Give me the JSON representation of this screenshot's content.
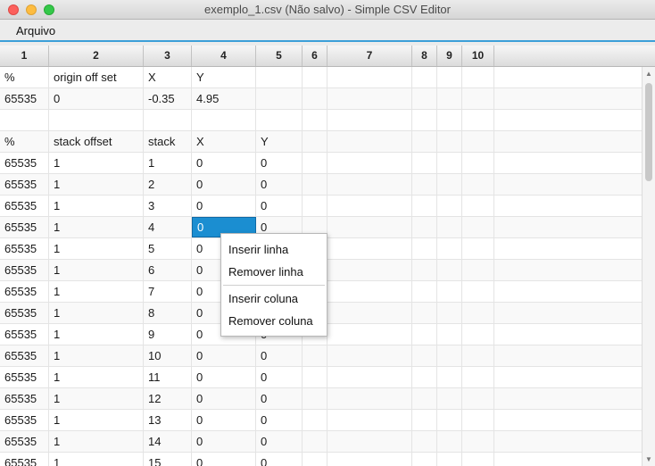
{
  "window": {
    "title": "exemplo_1.csv (Não salvo) - Simple CSV Editor"
  },
  "menubar": {
    "items": [
      "Arquivo"
    ]
  },
  "columns": [
    "1",
    "2",
    "3",
    "4",
    "5",
    "6",
    "7",
    "8",
    "9",
    "10"
  ],
  "rows": [
    [
      "%",
      "origin off set",
      "X",
      "Y",
      "",
      "",
      "",
      "",
      "",
      ""
    ],
    [
      "65535",
      "0",
      "-0.35",
      "4.95",
      "",
      "",
      "",
      "",
      "",
      ""
    ],
    [
      "",
      "",
      "",
      "",
      "",
      "",
      "",
      "",
      "",
      ""
    ],
    [
      "%",
      "stack offset",
      "stack",
      "X",
      "Y",
      "",
      "",
      "",
      "",
      ""
    ],
    [
      "65535",
      "1",
      "1",
      "0",
      "0",
      "",
      "",
      "",
      "",
      ""
    ],
    [
      "65535",
      "1",
      "2",
      "0",
      "0",
      "",
      "",
      "",
      "",
      ""
    ],
    [
      "65535",
      "1",
      "3",
      "0",
      "0",
      "",
      "",
      "",
      "",
      ""
    ],
    [
      "65535",
      "1",
      "4",
      "0",
      "0",
      "",
      "",
      "",
      "",
      ""
    ],
    [
      "65535",
      "1",
      "5",
      "0",
      "0",
      "",
      "",
      "",
      "",
      ""
    ],
    [
      "65535",
      "1",
      "6",
      "0",
      "0",
      "",
      "",
      "",
      "",
      ""
    ],
    [
      "65535",
      "1",
      "7",
      "0",
      "0",
      "",
      "",
      "",
      "",
      ""
    ],
    [
      "65535",
      "1",
      "8",
      "0",
      "0",
      "",
      "",
      "",
      "",
      ""
    ],
    [
      "65535",
      "1",
      "9",
      "0",
      "0",
      "",
      "",
      "",
      "",
      ""
    ],
    [
      "65535",
      "1",
      "10",
      "0",
      "0",
      "",
      "",
      "",
      "",
      ""
    ],
    [
      "65535",
      "1",
      "11",
      "0",
      "0",
      "",
      "",
      "",
      "",
      ""
    ],
    [
      "65535",
      "1",
      "12",
      "0",
      "0",
      "",
      "",
      "",
      "",
      ""
    ],
    [
      "65535",
      "1",
      "13",
      "0",
      "0",
      "",
      "",
      "",
      "",
      ""
    ],
    [
      "65535",
      "1",
      "14",
      "0",
      "0",
      "",
      "",
      "",
      "",
      ""
    ],
    [
      "65535",
      "1",
      "15",
      "0",
      "0",
      "",
      "",
      "",
      "",
      ""
    ]
  ],
  "selected_cell": {
    "row": 8,
    "column": 4
  },
  "context_menu": {
    "group1": [
      "Inserir linha",
      "Remover linha"
    ],
    "group2": [
      "Inserir coluna",
      "Remover coluna"
    ]
  },
  "colors": {
    "accent": "#1b8ed1",
    "menu_underline": "#3b9fd8"
  }
}
